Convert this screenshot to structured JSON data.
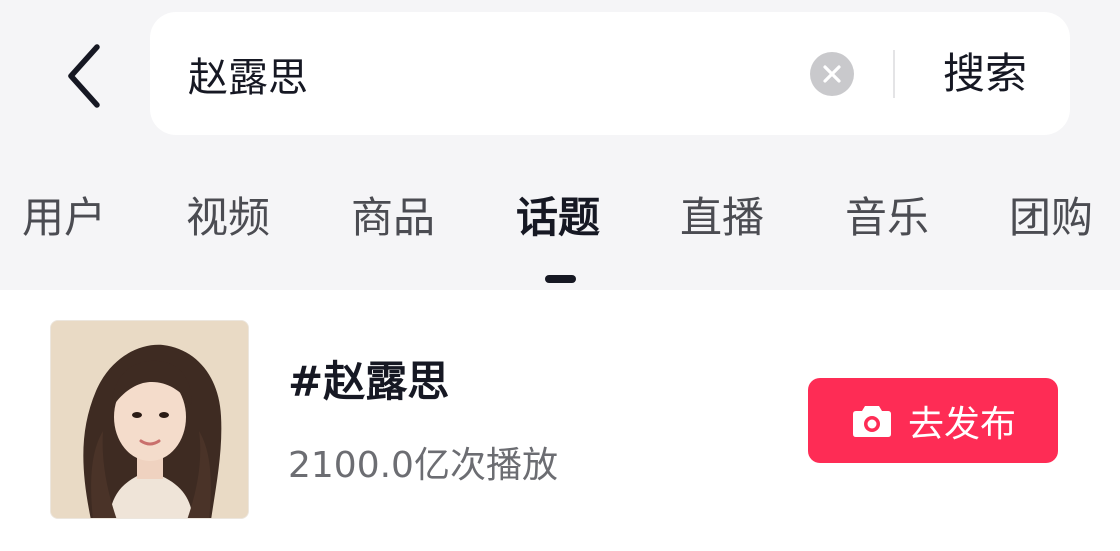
{
  "search": {
    "query": "赵露思",
    "submit_label": "搜索"
  },
  "tabs": [
    {
      "label": "用户"
    },
    {
      "label": "视频"
    },
    {
      "label": "商品"
    },
    {
      "label": "话题",
      "active": true
    },
    {
      "label": "直播"
    },
    {
      "label": "音乐"
    },
    {
      "label": "团购"
    }
  ],
  "result": {
    "title": "#赵露思",
    "plays": "2100.0亿次播放",
    "publish_label": "去发布"
  },
  "colors": {
    "accent": "#fe2c55",
    "text_primary": "#161823",
    "text_secondary": "#6c6d72",
    "header_bg": "#f5f5f7"
  },
  "icons": {
    "back": "chevron-left-icon",
    "clear": "clear-circle-icon",
    "publish": "camera-icon"
  }
}
